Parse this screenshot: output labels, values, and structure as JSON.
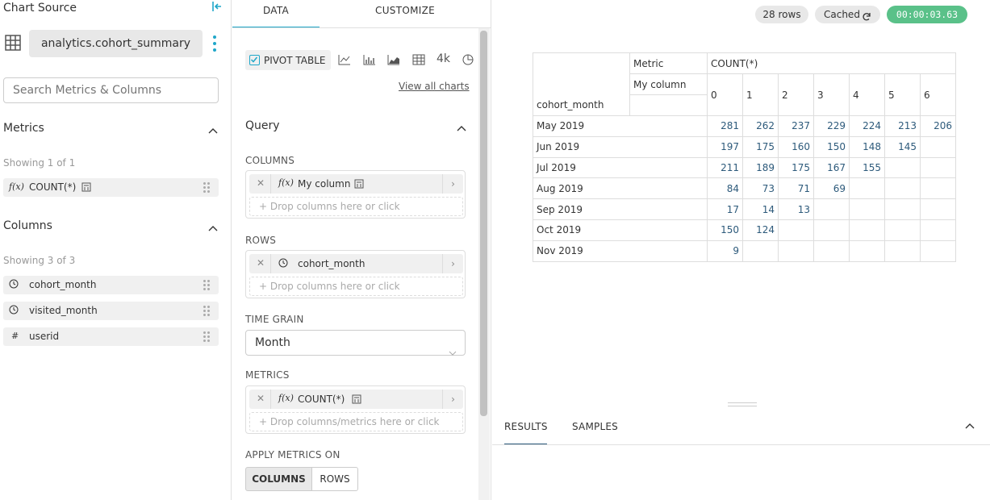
{
  "left": {
    "title": "Chart Source",
    "datasource": "analytics.cohort_summary",
    "search_placeholder": "Search Metrics & Columns",
    "metrics_header": "Metrics",
    "metrics_showing": "Showing 1 of 1",
    "metrics": [
      {
        "icon": "f(x)",
        "label": "COUNT(*)"
      }
    ],
    "columns_header": "Columns",
    "columns_showing": "Showing 3 of 3",
    "columns": [
      {
        "icon": "clock-icon",
        "label": "cohort_month"
      },
      {
        "icon": "clock-icon",
        "label": "visited_month"
      },
      {
        "icon": "hash-icon",
        "label": "userid"
      }
    ]
  },
  "mid": {
    "tabs": [
      "DATA",
      "CUSTOMIZE"
    ],
    "viz_label": "PIVOT TABLE",
    "big_number_label": "4k",
    "view_all": "View all charts",
    "query_header": "Query",
    "columns_label": "COLUMNS",
    "columns_pill": "My column",
    "columns_drop": "Drop columns here or click",
    "rows_label": "ROWS",
    "rows_pill": "cohort_month",
    "rows_drop": "Drop columns here or click",
    "time_grain_label": "TIME GRAIN",
    "time_grain_value": "Month",
    "metrics_label": "METRICS",
    "metrics_pill": "COUNT(*)",
    "metrics_drop": "Drop columns/metrics here or click",
    "apply_label": "APPLY METRICS ON",
    "apply_options": [
      "COLUMNS",
      "ROWS"
    ],
    "fx": "f(x)"
  },
  "right": {
    "rows_badge": "28 rows",
    "cached_badge": "Cached",
    "timer_badge": "00:00:03.63",
    "pivot": {
      "metric_label": "Metric",
      "metric_value": "COUNT(*)",
      "column_label": "My column",
      "row_label": "cohort_month",
      "col_keys": [
        "0",
        "1",
        "2",
        "3",
        "4",
        "5",
        "6"
      ],
      "rows": [
        {
          "label": "May 2019",
          "values": [
            "281",
            "262",
            "237",
            "229",
            "224",
            "213",
            "206"
          ]
        },
        {
          "label": "Jun 2019",
          "values": [
            "197",
            "175",
            "160",
            "150",
            "148",
            "145",
            ""
          ]
        },
        {
          "label": "Jul 2019",
          "values": [
            "211",
            "189",
            "175",
            "167",
            "155",
            "",
            ""
          ]
        },
        {
          "label": "Aug 2019",
          "values": [
            "84",
            "73",
            "71",
            "69",
            "",
            "",
            ""
          ]
        },
        {
          "label": "Sep 2019",
          "values": [
            "17",
            "14",
            "13",
            "",
            "",
            "",
            ""
          ]
        },
        {
          "label": "Oct 2019",
          "values": [
            "150",
            "124",
            "",
            "",
            "",
            "",
            ""
          ]
        },
        {
          "label": "Nov 2019",
          "values": [
            "9",
            "",
            "",
            "",
            "",
            "",
            ""
          ]
        }
      ]
    },
    "bottom_tabs": [
      "RESULTS",
      "SAMPLES"
    ]
  },
  "colors": {
    "accent": "#20a7c9",
    "success": "#5ac189",
    "link_num": "#2d5a7b"
  }
}
